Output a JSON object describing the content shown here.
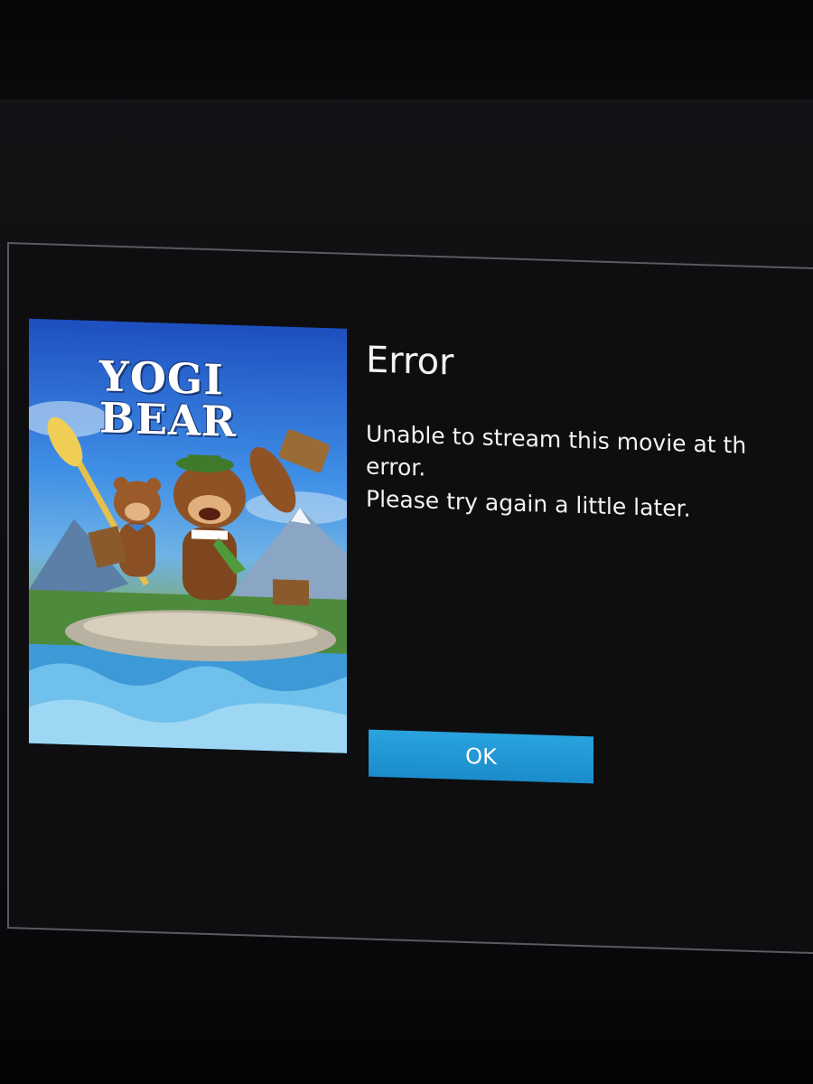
{
  "dialog": {
    "title": "Error",
    "message": "Unable to stream this movie at th\nerror.\nPlease try again a little later.",
    "ok_label": "OK"
  },
  "poster": {
    "title_line1": "YOGI",
    "title_line2": "BEAR"
  },
  "colors": {
    "accent": "#1f95d3",
    "background": "#0e0e10",
    "text": "#f2f2f2",
    "border": "#5a5a60"
  }
}
